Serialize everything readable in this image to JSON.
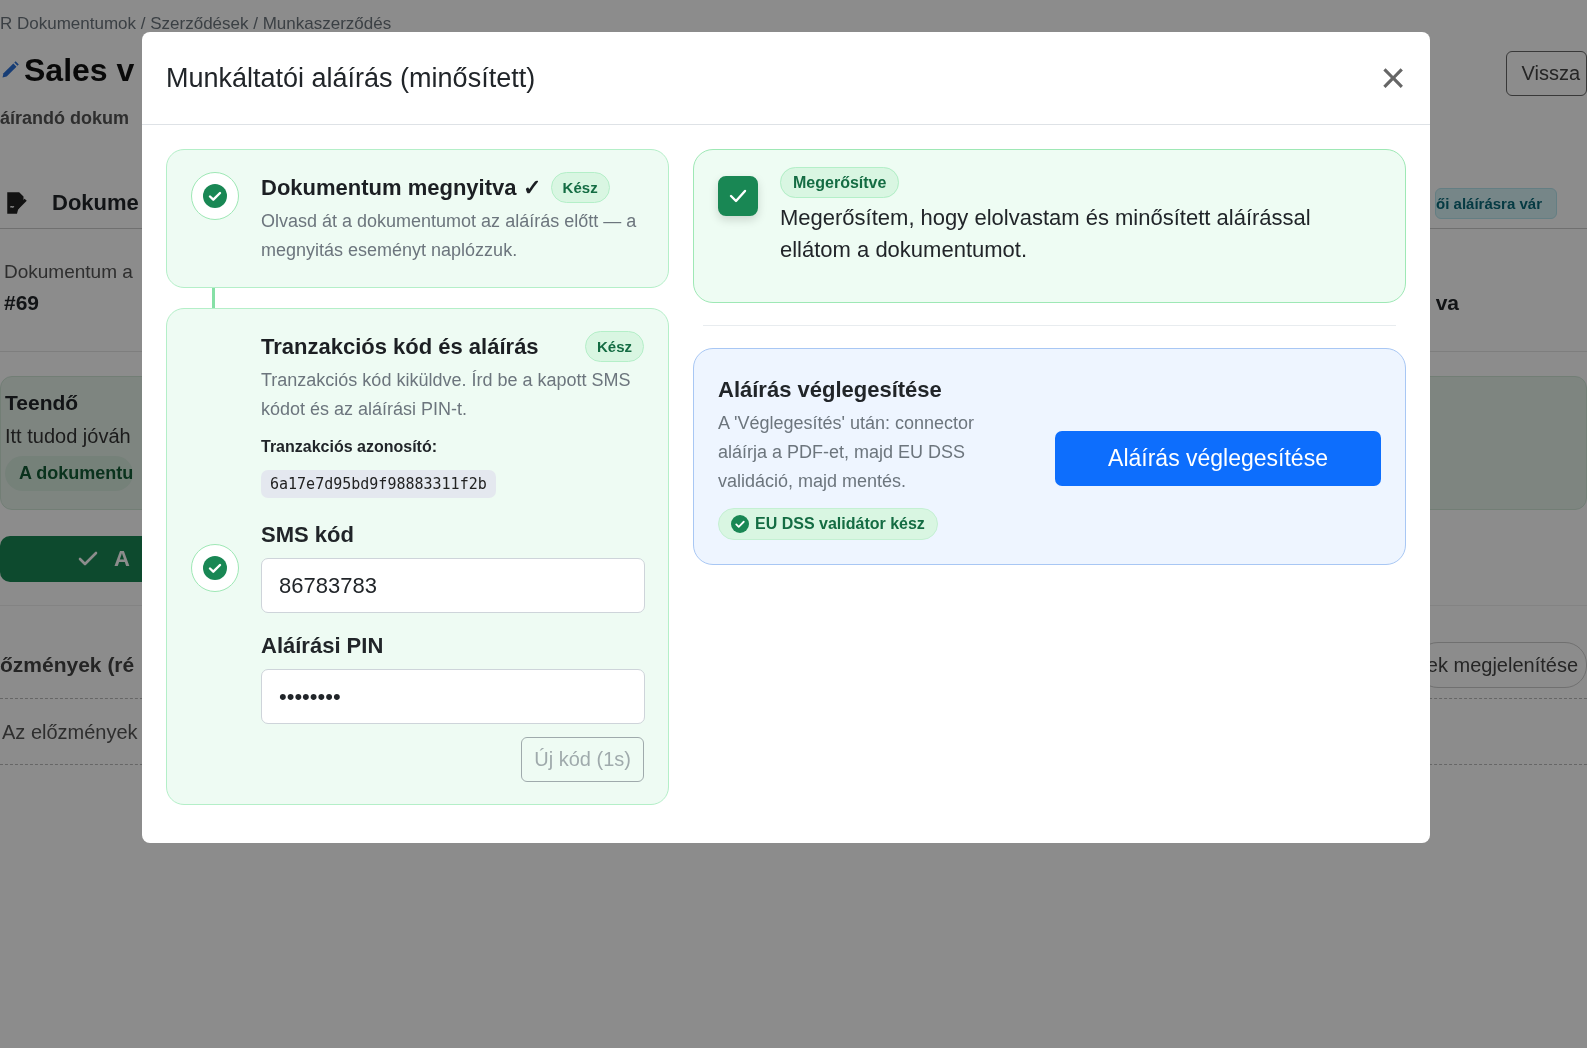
{
  "background": {
    "breadcrumb": "R Dokumentumok / Szerződések / Munkaszerződés",
    "title": "Sales v",
    "subtitle": "áírandó dokum",
    "back_button": "Vissza",
    "document_card": {
      "title": "Dokume",
      "status_badge": "ői aláírásra vár",
      "field_label": "Dokumentum a",
      "field_value": "#69",
      "field_value_2": "va"
    },
    "todo": {
      "title": "Teendő",
      "text": "Itt tudod jóváh",
      "badge": "A dokumentu",
      "button": "A"
    },
    "history": {
      "title": "őzmények (ré",
      "toggle_button": "ek megjelenítése",
      "empty_text": "Az előzmények"
    }
  },
  "modal": {
    "title": "Munkáltatói aláírás (minősített)",
    "close": "×",
    "steps": [
      {
        "kind": "opened",
        "title": "Dokumentum megnyitva ✓",
        "badge": "Kész",
        "description": "Olvasd át a dokumentumot az aláírás előtt — a megnyitás eseményt naplózzuk.",
        "done": true
      },
      {
        "kind": "code",
        "title": "Tranzakciós kód és aláírás",
        "badge": "Kész",
        "description": "Tranzakciós kód kiküldve. Írd be a kapott SMS kódot és az aláírási PIN-t.",
        "transaction_id_label": "Tranzakciós azonosító:",
        "transaction_id": "6a17e7d95bd9f98883311f2b",
        "fields": [
          {
            "label": "SMS kód",
            "value": "86783783",
            "done": true
          },
          {
            "label": "Aláírási PIN",
            "value": "••••••••"
          }
        ],
        "resend_button": {
          "label": "Új kód (1s)",
          "disabled": true
        }
      }
    ],
    "confirmation": {
      "checked": true,
      "badge": "Megerősítve",
      "text": "Megerősítem, hogy elolvastam és minősített aláírással ellátom a dokumentumot."
    },
    "finalize": {
      "title": "Aláírás véglegesítése",
      "description": "A 'Véglegesítés' után: connector aláírja a PDF-et, majd EU DSS validáció, majd mentés.",
      "validator_badge": "EU DSS validátor kész",
      "button": "Aláírás véglegesítése"
    }
  }
}
